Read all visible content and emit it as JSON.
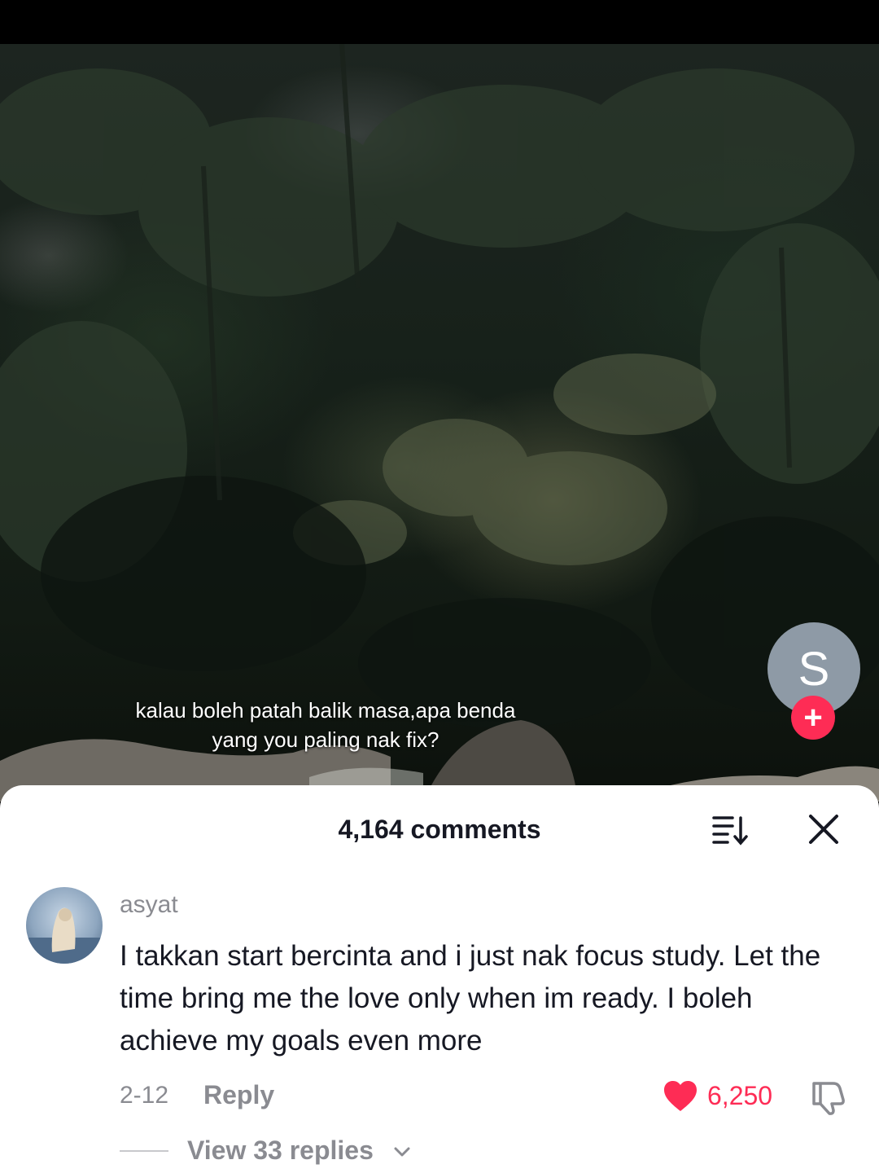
{
  "video": {
    "caption_line1": "kalau boleh patah balik masa,apa benda",
    "caption_line2": "yang you paling nak fix?",
    "creator_initial": "S",
    "follow_symbol": "+"
  },
  "comments_sheet": {
    "title": "4,164 comments",
    "sort_icon": "sort-icon",
    "close_icon": "close-icon"
  },
  "comment": {
    "username": "asyat",
    "text": "I takkan start bercinta and i just nak focus study. Let the time bring me the love only when im ready. I boleh achieve my goals even more",
    "date": "2-12",
    "reply_label": "Reply",
    "like_count": "6,250",
    "view_replies": "View 33 replies"
  },
  "colors": {
    "accent": "#fe2c55",
    "text_primary": "#161823",
    "text_secondary": "#8a8b91",
    "creator_avatar": "#8e9aa6"
  }
}
